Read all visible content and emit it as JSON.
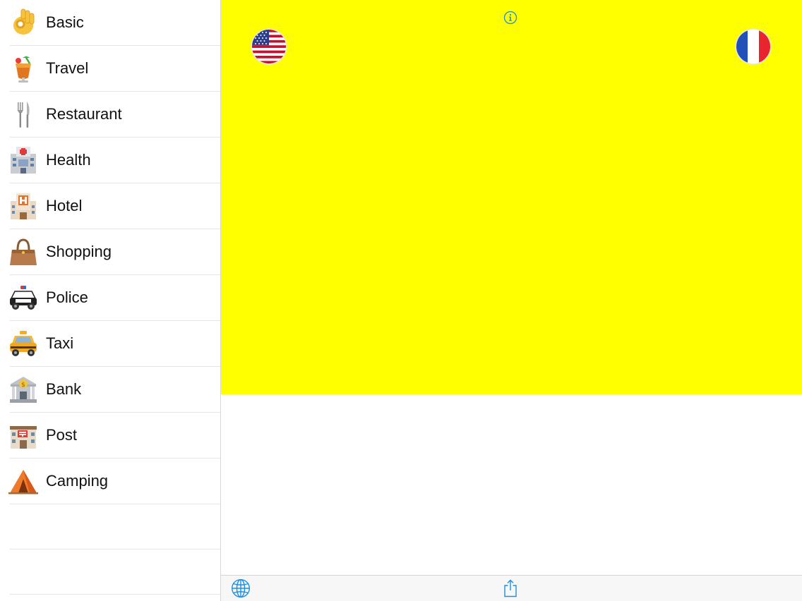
{
  "sidebar": {
    "categories": [
      {
        "label": "Basic",
        "icon": "ok-hand-icon"
      },
      {
        "label": "Travel",
        "icon": "tropical-drink-icon"
      },
      {
        "label": "Restaurant",
        "icon": "fork-and-knife-icon"
      },
      {
        "label": "Health",
        "icon": "hospital-icon"
      },
      {
        "label": "Hotel",
        "icon": "hotel-icon"
      },
      {
        "label": "Shopping",
        "icon": "handbag-icon"
      },
      {
        "label": "Police",
        "icon": "police-car-icon"
      },
      {
        "label": "Taxi",
        "icon": "taxi-icon"
      },
      {
        "label": "Bank",
        "icon": "bank-icon"
      },
      {
        "label": "Post",
        "icon": "post-office-icon"
      },
      {
        "label": "Camping",
        "icon": "camping-tent-icon"
      }
    ]
  },
  "main": {
    "panel_color": "#ffff00",
    "source_language_flag": "us-flag-icon",
    "target_language_flag": "france-flag-icon",
    "accent_color": "#1a8fe3"
  },
  "toolbar": {
    "left_icon": "globe-icon",
    "center_icon": "share-icon"
  }
}
